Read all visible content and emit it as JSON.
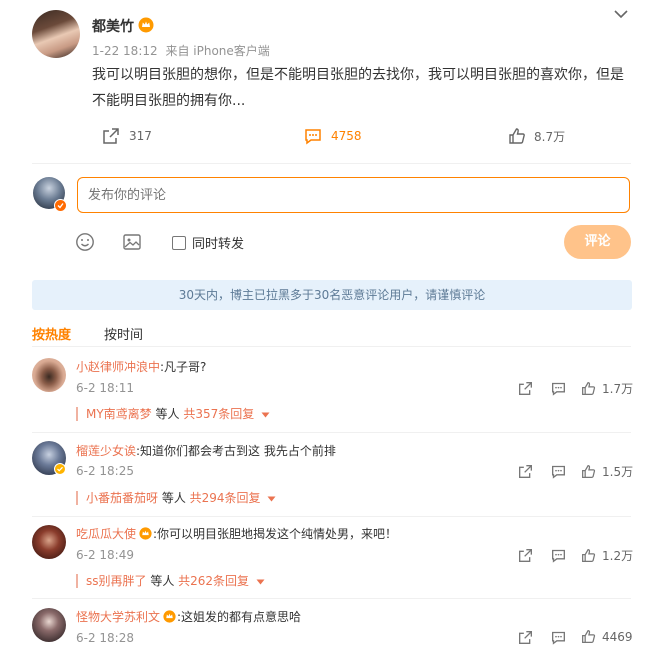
{
  "post": {
    "author": "都美竹",
    "time": "1-22 18:12",
    "source": "来自 iPhone客户端",
    "text": "我可以明目张胆的想你，但是不能明目张胆的去找你，我可以明目张胆的喜欢你，但是不能明目张胆的拥有你...",
    "repost_count": "317",
    "comment_count": "4758",
    "like_count": "8.7万"
  },
  "compose": {
    "placeholder": "发布你的评论",
    "forward_label": "同时转发",
    "submit_label": "评论"
  },
  "notice": "30天内，博主已拉黑多于30名恶意评论用户，请谨慎评论",
  "sort_tabs": [
    "按热度",
    "按时间"
  ],
  "comments": [
    {
      "user": "小赵律师冲浪中",
      "text": ":凡子哥?",
      "time": "6-2 18:11",
      "likes": "1.7万",
      "reply_user": "MY南鸢离梦",
      "reply_mid": " 等人 ",
      "reply_count": "共357条回复"
    },
    {
      "user": "榴莲少女诶",
      "text": ":知道你们都会考古到这 我先占个前排",
      "time": "6-2 18:25",
      "likes": "1.5万",
      "reply_user": "小番茄番茄呀",
      "reply_mid": " 等人 ",
      "reply_count": "共294条回复"
    },
    {
      "user": "吃瓜瓜大使",
      "text": ":你可以明目张胆地揭发这个纯情处男，来吧！",
      "time": "6-2 18:49",
      "likes": "1.2万",
      "reply_user": "ss别再胖了",
      "reply_mid": " 等人 ",
      "reply_count": "共262条回复"
    },
    {
      "user": "怪物大学苏利文",
      "text": ":这姐发的都有点意思哈",
      "time": "6-2 18:28",
      "likes": "4469"
    }
  ],
  "colors": {
    "accent": "#ff8200",
    "link": "#eb7350",
    "notice_bg": "#e6f1fb",
    "notice_text": "#5d7a96",
    "submit_bg": "#ffc38a"
  }
}
